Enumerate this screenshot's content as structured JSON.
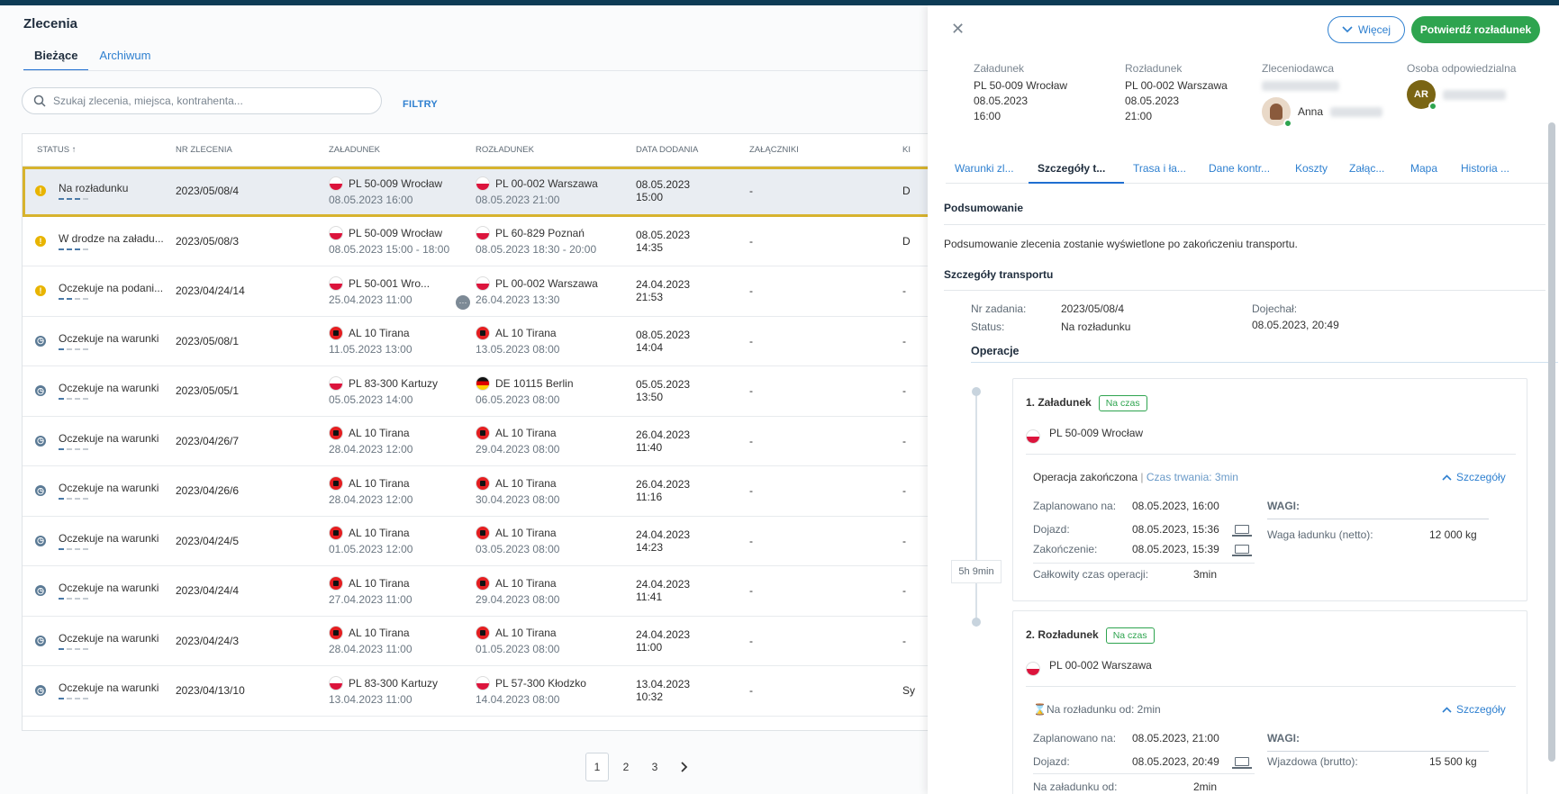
{
  "page": {
    "title": "Zlecenia",
    "tabs": [
      "Bieżące",
      "Archiwum"
    ]
  },
  "search": {
    "placeholder": "Szukaj zlecenia, miejsca, kontrahenta...",
    "filters_label": "FILTRY"
  },
  "table": {
    "columns": [
      "STATUS ↑",
      "NR ZLECENIA",
      "ZAŁADUNEK",
      "ROZŁADUNEK",
      "DATA DODANIA",
      "ZAŁĄCZNIKI",
      "KI"
    ],
    "rows": [
      {
        "status": "Na rozładunku",
        "icon": "warn",
        "progress": 3,
        "nr": "2023/05/08/4",
        "load": "PL 50-009 Wrocław",
        "load_date": "08.05.2023 16:00",
        "load_flag": "pl",
        "unload": "PL 00-002 Warszawa",
        "unload_date": "08.05.2023 21:00",
        "unload_flag": "pl",
        "added_date": "08.05.2023",
        "added_time": "15:00",
        "att": "-",
        "k": "D"
      },
      {
        "status": "W drodze na załadu...",
        "icon": "warn",
        "progress": 3,
        "nr": "2023/05/08/3",
        "load": "PL 50-009 Wrocław",
        "load_date": "08.05.2023 15:00 - 18:00",
        "load_flag": "pl",
        "unload": "PL 60-829 Poznań",
        "unload_date": "08.05.2023 18:30 - 20:00",
        "unload_flag": "pl",
        "added_date": "08.05.2023",
        "added_time": "14:35",
        "att": "-",
        "k": "D"
      },
      {
        "status": "Oczekuje na podani...",
        "icon": "warn",
        "progress": 2,
        "nr": "2023/04/24/14",
        "load": "PL 50-001 Wro...",
        "load_date": "25.04.2023 11:00",
        "load_flag": "pl",
        "unload": "PL 00-002 Warszawa",
        "unload_date": "26.04.2023 13:30",
        "unload_flag": "pl",
        "added_date": "24.04.2023",
        "added_time": "21:53",
        "att": "-",
        "k": "-"
      },
      {
        "status": "Oczekuje na warunki",
        "icon": "clock",
        "progress": 1,
        "nr": "2023/05/08/1",
        "load": "AL 10 Tirana",
        "load_date": "11.05.2023 13:00",
        "load_flag": "al",
        "unload": "AL 10 Tirana",
        "unload_date": "13.05.2023 08:00",
        "unload_flag": "al",
        "added_date": "08.05.2023",
        "added_time": "14:04",
        "att": "-",
        "k": "-"
      },
      {
        "status": "Oczekuje na warunki",
        "icon": "clock",
        "progress": 1,
        "nr": "2023/05/05/1",
        "load": "PL 83-300 Kartuzy",
        "load_date": "05.05.2023 14:00",
        "load_flag": "pl",
        "unload": "DE 10115 Berlin",
        "unload_date": "06.05.2023 08:00",
        "unload_flag": "de",
        "added_date": "05.05.2023",
        "added_time": "13:50",
        "att": "-",
        "k": "-"
      },
      {
        "status": "Oczekuje na warunki",
        "icon": "clock",
        "progress": 1,
        "nr": "2023/04/26/7",
        "load": "AL 10 Tirana",
        "load_date": "28.04.2023 12:00",
        "load_flag": "al",
        "unload": "AL 10 Tirana",
        "unload_date": "29.04.2023 08:00",
        "unload_flag": "al",
        "added_date": "26.04.2023",
        "added_time": "11:40",
        "att": "-",
        "k": "-"
      },
      {
        "status": "Oczekuje na warunki",
        "icon": "clock",
        "progress": 1,
        "nr": "2023/04/26/6",
        "load": "AL 10 Tirana",
        "load_date": "28.04.2023 12:00",
        "load_flag": "al",
        "unload": "AL 10 Tirana",
        "unload_date": "30.04.2023 08:00",
        "unload_flag": "al",
        "added_date": "26.04.2023",
        "added_time": "11:16",
        "att": "-",
        "k": "-"
      },
      {
        "status": "Oczekuje na warunki",
        "icon": "clock",
        "progress": 1,
        "nr": "2023/04/24/5",
        "load": "AL 10 Tirana",
        "load_date": "01.05.2023 12:00",
        "load_flag": "al",
        "unload": "AL 10 Tirana",
        "unload_date": "03.05.2023 08:00",
        "unload_flag": "al",
        "added_date": "24.04.2023",
        "added_time": "14:23",
        "att": "-",
        "k": "-"
      },
      {
        "status": "Oczekuje na warunki",
        "icon": "clock",
        "progress": 1,
        "nr": "2023/04/24/4",
        "load": "AL 10 Tirana",
        "load_date": "27.04.2023 11:00",
        "load_flag": "al",
        "unload": "AL 10 Tirana",
        "unload_date": "29.04.2023 08:00",
        "unload_flag": "al",
        "added_date": "24.04.2023",
        "added_time": "11:41",
        "att": "-",
        "k": "-"
      },
      {
        "status": "Oczekuje na warunki",
        "icon": "clock",
        "progress": 1,
        "nr": "2023/04/24/3",
        "load": "AL 10 Tirana",
        "load_date": "28.04.2023 11:00",
        "load_flag": "al",
        "unload": "AL 10 Tirana",
        "unload_date": "01.05.2023 08:00",
        "unload_flag": "al",
        "added_date": "24.04.2023",
        "added_time": "11:00",
        "att": "-",
        "k": "-"
      },
      {
        "status": "Oczekuje na warunki",
        "icon": "clock",
        "progress": 1,
        "nr": "2023/04/13/10",
        "load": "PL 83-300 Kartuzy",
        "load_date": "13.04.2023 11:00",
        "load_flag": "pl",
        "unload": "PL 57-300 Kłodzko",
        "unload_date": "14.04.2023 08:00",
        "unload_flag": "pl",
        "added_date": "13.04.2023",
        "added_time": "10:32",
        "att": "-",
        "k": "Sy"
      }
    ]
  },
  "pager": {
    "pages": [
      "1",
      "2",
      "3"
    ],
    "next": "›"
  },
  "panel": {
    "more_label": "Więcej",
    "confirm_label": "Potwierdź rozładunek",
    "loading": {
      "h": "Załadunek",
      "place": "PL 50-009 Wrocław",
      "date": "08.05.2023",
      "time": "16:00"
    },
    "unloading": {
      "h": "Rozładunek",
      "place": "PL 00-002 Warszawa",
      "date": "08.05.2023",
      "time": "21:00"
    },
    "client": {
      "h": "Zleceniodawca",
      "person": "Anna"
    },
    "owner": {
      "h": "Osoba odpowiedzialna",
      "initials": "AR"
    },
    "tabs": [
      "Warunki zl...",
      "Szczegóły t...",
      "Trasa i ła...",
      "Dane kontr...",
      "Koszty",
      "Załąc...",
      "Mapa",
      "Historia ..."
    ],
    "summary_title": "Podsumowanie",
    "summary_text": "Podsumowanie zlecenia zostanie wyświetlone po zakończeniu transportu.",
    "details_title": "Szczegóły transportu",
    "nr_label": "Nr zadania:",
    "nr_value": "2023/05/08/4",
    "status_label": "Status:",
    "status_value": "Na rozładunku",
    "arrived_label": "Dojechał:",
    "arrived_value": "08.05.2023, 20:49",
    "ops_title": "Operacje",
    "duration": "5h 9min",
    "op1": {
      "title": "1. Załadunek",
      "badge": "Na czas",
      "place": "PL 50-009 Wrocław",
      "done": "Operacja zakończona",
      "dur": "Czas trwania: 3min",
      "details": "Szczegóły",
      "planned_l": "Zaplanowano na:",
      "planned_v": "08.05.2023, 16:00",
      "arrival_l": "Dojazd:",
      "arrival_v": "08.05.2023, 15:36",
      "end_l": "Zakończenie:",
      "end_v": "08.05.2023, 15:39",
      "total_l": "Całkowity czas operacji:",
      "total_v": "3min",
      "weights": "WAGI:",
      "w_l": "Waga ładunku (netto):",
      "w_v": "12 000 kg"
    },
    "op2": {
      "title": "2. Rozładunek",
      "badge": "Na czas",
      "place": "PL 00-002 Warszawa",
      "status": "Na rozładunku od: 2min",
      "details": "Szczegóły",
      "planned_l": "Zaplanowano na:",
      "planned_v": "08.05.2023, 21:00",
      "arrival_l": "Dojazd:",
      "arrival_v": "08.05.2023, 20:49",
      "since_l": "Na załadunku od:",
      "since_v": "2min",
      "weights": "WAGI:",
      "w_l": "Wjazdowa (brutto):",
      "w_v": "15 500 kg"
    }
  }
}
